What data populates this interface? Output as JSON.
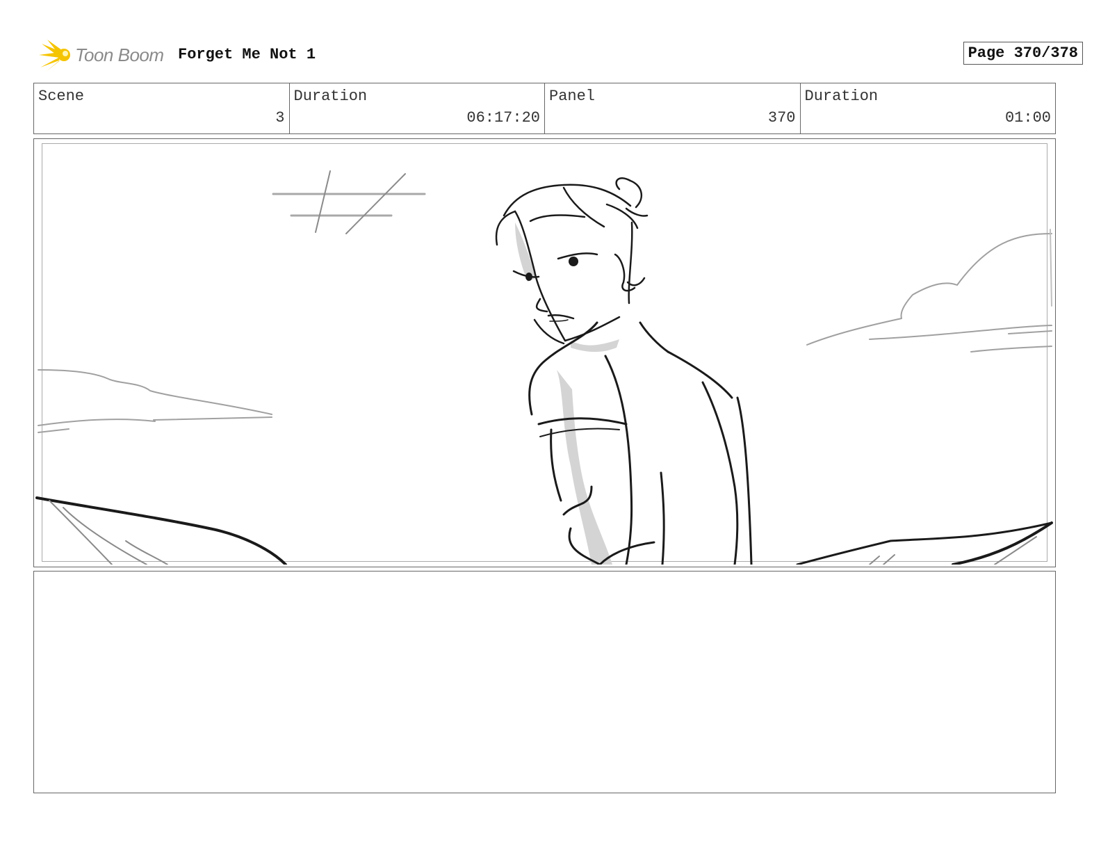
{
  "header": {
    "brand": "Toon Boom",
    "title": "Forget Me Not 1",
    "page": "Page 370/378"
  },
  "info": {
    "scene_label": "Scene",
    "scene_value": "3",
    "scene_duration_label": "Duration",
    "scene_duration_value": "06:17:20",
    "panel_label": "Panel",
    "panel_value": "370",
    "panel_duration_label": "Duration",
    "panel_duration_value": "01:00"
  },
  "colors": {
    "logo_accent": "#f5c400",
    "frame_border": "#666666",
    "sketch_line": "#1a1a1a",
    "sketch_soft": "#9a9a9a",
    "sketch_shade": "#d4d4d4"
  },
  "icons": {
    "logo": "toon-boom-starburst-icon"
  }
}
